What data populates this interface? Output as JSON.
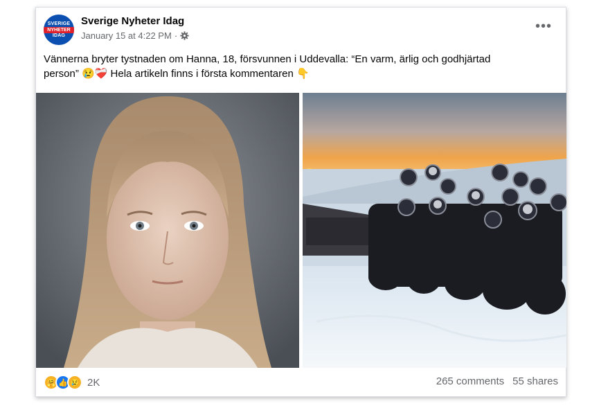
{
  "post": {
    "page_name": "Sverige Nyheter Idag",
    "timestamp": "January 15 at 4:22 PM",
    "separator": "·",
    "avatar_text": [
      "SVERIGE",
      "NYHETER",
      "IDAG"
    ],
    "text_line1": "Vännerna bryter tystnaden om Hanna, 18, försvunnen i Uddevalla: “En varm, ärlig och godhjärtad",
    "text_line2": "person” 😢❤️‍🩹 Hela artikeln finns i första kommentaren 👇",
    "more_label": "•••"
  },
  "photos": [
    {
      "name": "portrait-photo"
    },
    {
      "name": "group-snow-photo"
    }
  ],
  "footer": {
    "reactions": [
      "care",
      "like",
      "sad"
    ],
    "reaction_count": "2K",
    "comments": "265 comments",
    "shares": "55 shares"
  },
  "colors": {
    "brand_blue": "#0b4fb0",
    "brand_red": "#e0202a",
    "like_blue": "#1877f2",
    "secondary_text": "#65676b"
  }
}
